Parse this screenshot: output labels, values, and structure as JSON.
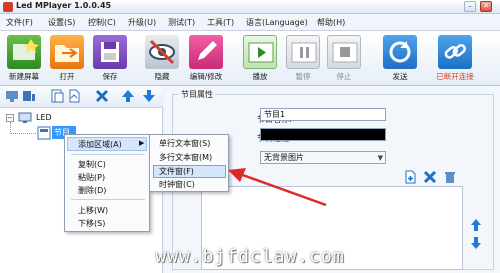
{
  "window": {
    "title": "Led MPlayer 1.0.0.45",
    "minimize": "–",
    "close": "✕"
  },
  "menu": [
    "文件(F)",
    "设置(S)",
    "控制(C)",
    "升级(U)",
    "测试(T)",
    "工具(T)",
    "语言(Language)",
    "帮助(H)"
  ],
  "toolbar": {
    "new_screen": "新建屏幕",
    "open": "打开",
    "save": "保存",
    "hide": "隐藏",
    "edit": "编辑/修改",
    "play": "播放",
    "pause": "暂停",
    "stop": "停止",
    "send": "发送",
    "reconnect": "已断开连接"
  },
  "tree": {
    "root": "LED",
    "child": "节目1"
  },
  "props": {
    "group_title": "节目属性",
    "name_label": "节目名称:",
    "name_value": "节目1",
    "frame_label": "节目边框:",
    "bg_value": "无背景图片"
  },
  "context_menu": {
    "add_area": "添加区域(A)",
    "copy": "复制(C)",
    "paste": "粘贴(P)",
    "delete": "删除(D)",
    "move_up": "上移(W)",
    "move_down": "下移(S)"
  },
  "submenu": {
    "single_text": "单行文本窗(S)",
    "multi_text": "多行文本窗(M)",
    "file_window": "文件窗(F)",
    "clock_window": "时钟窗(C)"
  },
  "watermark": "www.bjfdclaw.com",
  "colors": {
    "highlight": "#3399ff",
    "arrow": "#e0272a",
    "accent": "#1d7ad6"
  }
}
